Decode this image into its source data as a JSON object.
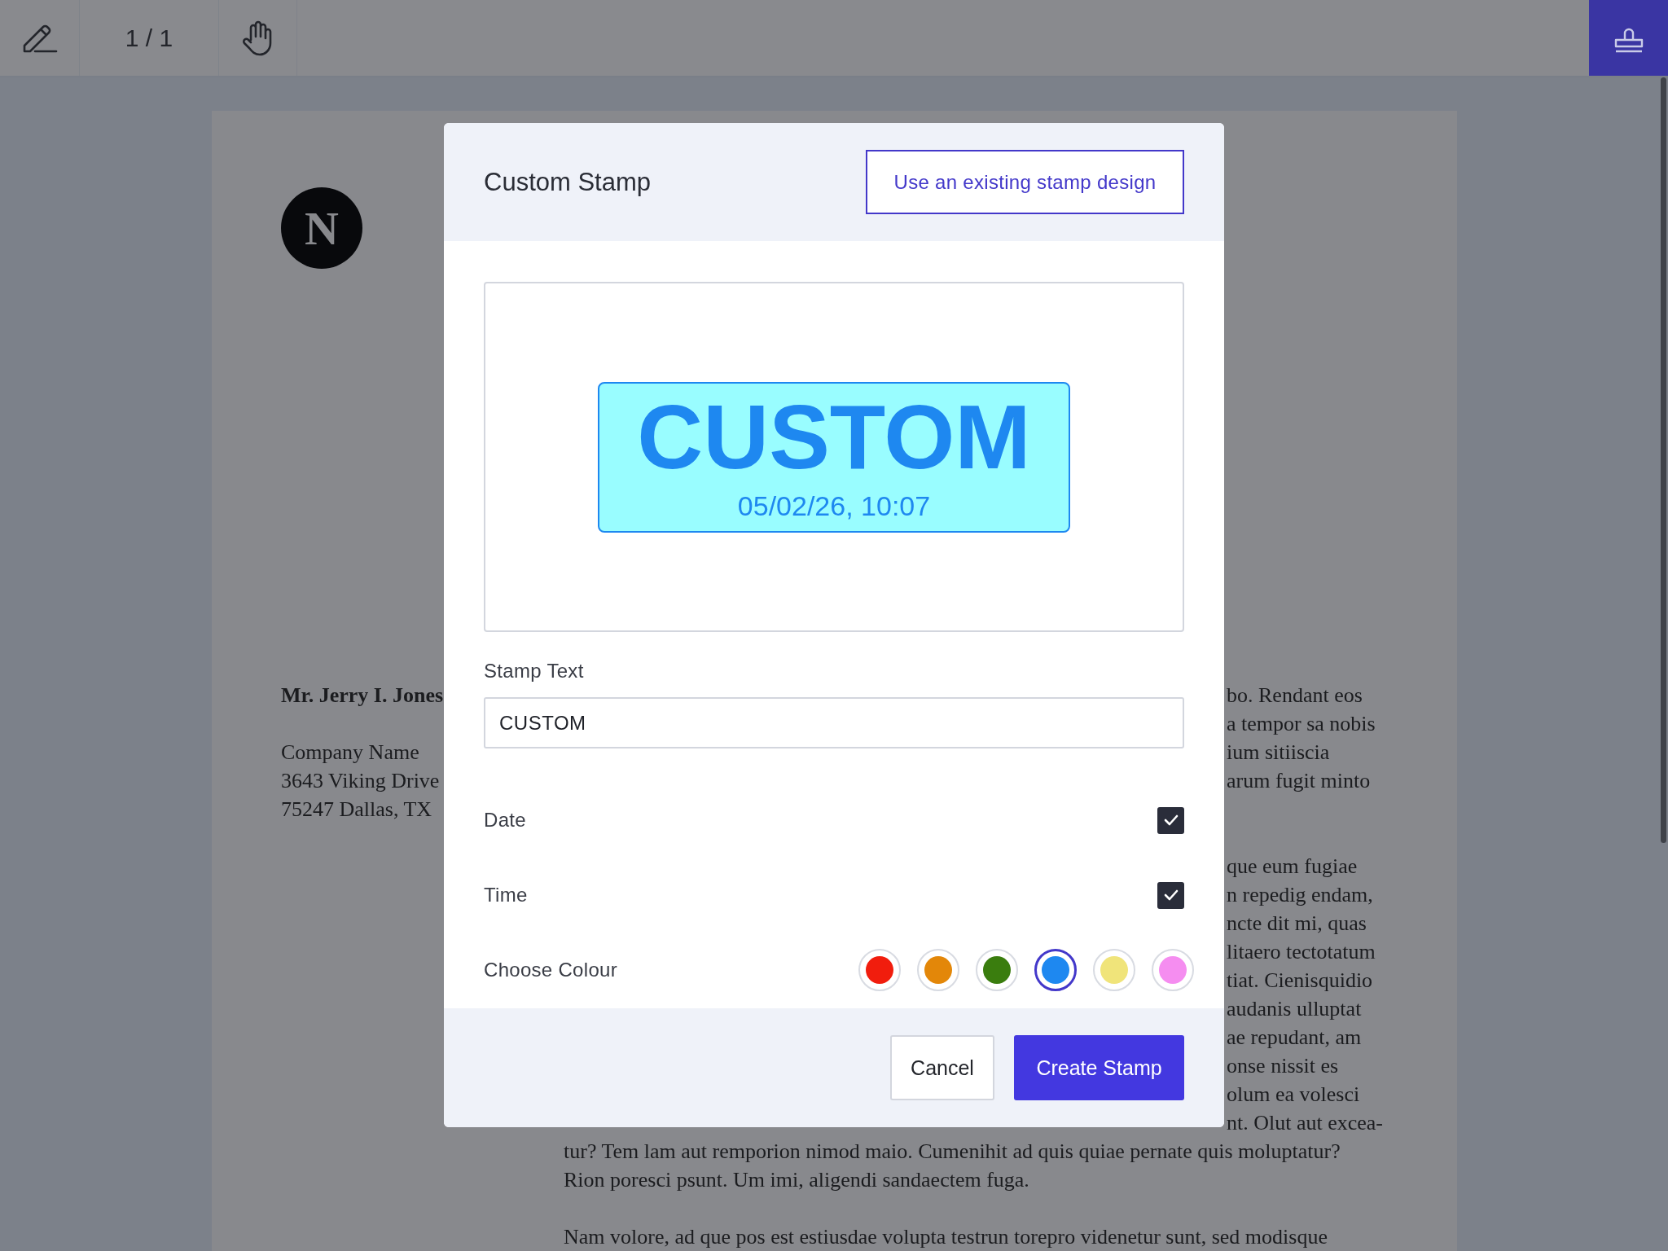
{
  "toolbar": {
    "page_indicator": "1 / 1"
  },
  "document": {
    "logo_letter": "N",
    "recipient": {
      "name": "Mr. Jerry I. Jones",
      "lines": [
        "Company Name",
        "3643 Viking Drive",
        "75247 Dallas, TX"
      ]
    },
    "paragraphs": [
      {
        "lines": [
          "bo. Rendant eos",
          "a tempor sa nobis",
          "ium sitiiscia",
          "arum fugit minto"
        ]
      },
      {
        "lines": [
          "que eum fugiae",
          "n repedig endam,",
          "ncte dit mi, quas",
          "litaero tectotatum",
          "tiat. Cienisquidio",
          "audanis ulluptat",
          "ae repudant, am",
          "onse nissit es",
          "olum ea volesci",
          "nt. Olut aut excea-",
          "tur? Tem lam aut remporion nimod maio. Cumenihit ad quis quiae pernate quis moluptatur?",
          "Rion poresci psunt. Um imi, aligendi sandaectem fuga."
        ]
      },
      {
        "lines": [
          "Nam volore, ad que pos est estiusdae volupta testrun torepro videnetur sunt, sed modisque"
        ]
      }
    ]
  },
  "dialog": {
    "title": "Custom Stamp",
    "existing_design_link": "Use an existing stamp design",
    "preview": {
      "text": "CUSTOM",
      "timestamp": "05/02/26, 10:07"
    },
    "stamp_text": {
      "label": "Stamp Text",
      "value": "CUSTOM"
    },
    "options": [
      {
        "label": "Date",
        "checked": true
      },
      {
        "label": "Time",
        "checked": true
      }
    ],
    "colour": {
      "label": "Choose Colour",
      "swatches": [
        {
          "color": "#f11d0d",
          "selected": false
        },
        {
          "color": "#e38709",
          "selected": false
        },
        {
          "color": "#3a7d0e",
          "selected": false
        },
        {
          "color": "#1e88f0",
          "selected": true
        },
        {
          "color": "#f0e47a",
          "selected": false
        },
        {
          "color": "#f58df0",
          "selected": false
        }
      ]
    },
    "buttons": {
      "cancel": "Cancel",
      "create": "Create Stamp"
    }
  }
}
